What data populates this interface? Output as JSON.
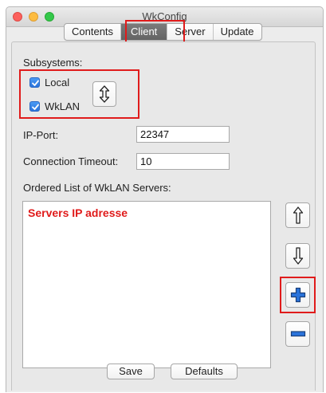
{
  "window": {
    "title": "WkConfig"
  },
  "tabs": [
    {
      "label": "Contents",
      "active": false
    },
    {
      "label": "Client",
      "active": true
    },
    {
      "label": "Server",
      "active": false
    },
    {
      "label": "Update",
      "active": false
    }
  ],
  "subsystems": {
    "label": "Subsystems:",
    "items": [
      {
        "label": "Local",
        "checked": true
      },
      {
        "label": "WkLAN",
        "checked": true
      }
    ],
    "swap_icon": "up-down-arrow-icon"
  },
  "ip_port": {
    "label": "IP-Port:",
    "value": "22347"
  },
  "timeout": {
    "label": "Connection Timeout:",
    "value": "10"
  },
  "servers": {
    "label": "Ordered List of WkLAN Servers:",
    "placeholder": "Servers IP adresse",
    "buttons": [
      "move-up-icon",
      "move-down-icon",
      "add-icon",
      "remove-icon"
    ]
  },
  "footer": {
    "save_label": "Save",
    "defaults_label": "Defaults"
  },
  "colors": {
    "highlight": "#e01b1b",
    "checkbox": "#2a73db",
    "placeholder_text": "#e01b1b"
  }
}
